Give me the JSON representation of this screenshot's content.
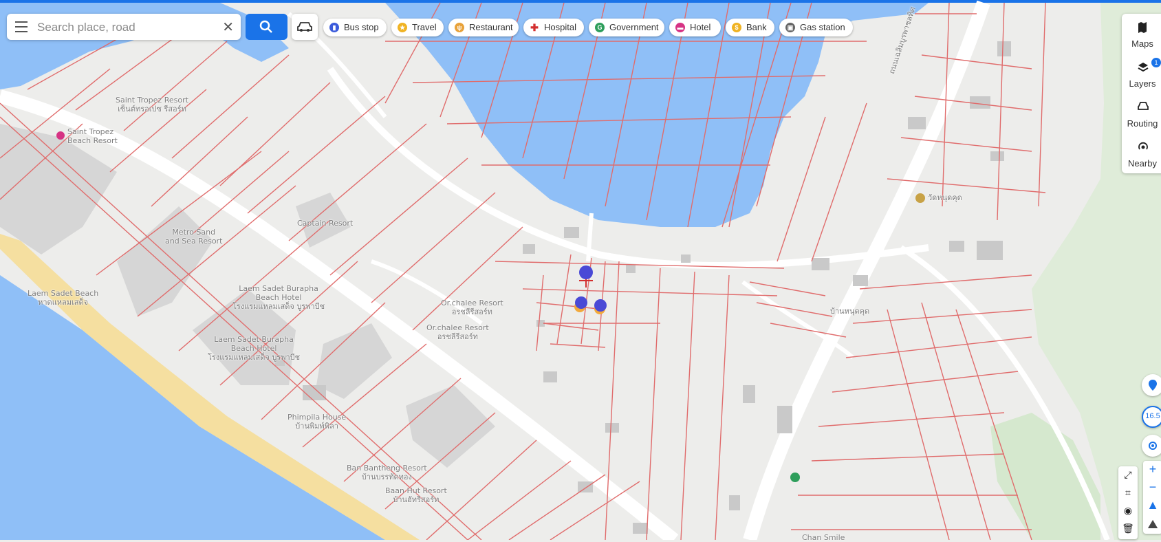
{
  "search": {
    "placeholder": "Search place, road",
    "value": ""
  },
  "categories": [
    {
      "label": "Bus stop",
      "icon": "bus-icon",
      "color": "#3b5bdb"
    },
    {
      "label": "Travel",
      "icon": "star-icon",
      "color": "#f0b323"
    },
    {
      "label": "Restaurant",
      "icon": "fork-knife-icon",
      "color": "#e8a23a"
    },
    {
      "label": "Hospital",
      "icon": "medical-cross-icon",
      "color": "#d32f2f"
    },
    {
      "label": "Government",
      "icon": "government-icon",
      "color": "#2e9e5b"
    },
    {
      "label": "Hotel",
      "icon": "bed-icon",
      "color": "#d63384"
    },
    {
      "label": "Bank",
      "icon": "coin-icon",
      "color": "#f0b323"
    },
    {
      "label": "Gas station",
      "icon": "fuel-pump-icon",
      "color": "#666666"
    }
  ],
  "side_panel": {
    "items": [
      {
        "label": "Maps",
        "icon": "map-icon"
      },
      {
        "label": "Layers",
        "icon": "layers-icon",
        "badge": "1"
      },
      {
        "label": "Routing",
        "icon": "car-icon"
      },
      {
        "label": "Nearby",
        "icon": "nearby-icon"
      }
    ]
  },
  "map_controls": {
    "zoom_level": "16.5",
    "zoom_in": "+",
    "zoom_out": "−"
  },
  "map_labels": {
    "l1": "Saint Tropez Resort",
    "l2": "เซ็นต์ทรอเปซ รีสอร์ท",
    "l3": "Saint Tropez",
    "l4": "Beach Resort",
    "l5": "Laem Sadet Beach",
    "l6": "หาดแหลมเสด็จ",
    "l7": "Laem Sadet Burapha",
    "l8": "Beach Hotel",
    "l9": "โรงแรมแหลมเสด็จ บูรพาบีช",
    "l10": "Laem Sadet Burapha",
    "l11": "Beach Hotel",
    "l12": "โรงแรมแหลมเสด็จ บูรพาบีช",
    "l13": "Metro Sand",
    "l14": "and Sea Resort",
    "l15": "Or.chalee Resort",
    "l16": "อรชลีรีสอร์ท",
    "l17": "Or.chalee Resort",
    "l18": "อรชลีรีสอร์ท",
    "l19": "Phimpila House",
    "l20": "บ้านพิมพ์พิลา",
    "l21": "Ban Bantheng Resort",
    "l22": "บ้านบรรทัดทอง",
    "l23": "Baan Hut Resort",
    "l24": "บ้านฮัทรีสอร์ท",
    "l25": "วัดหนุดคุด",
    "l26": "บ้านหนุดคุด",
    "l27": "ถนนเฉลิมบูรพาชลทิศ",
    "l28": "Chan Smile",
    "l29": "Captain Resort"
  },
  "colors": {
    "water": "#8fbff7",
    "land": "#ededeb",
    "beach": "#f5dfa0",
    "parcel": "#e06c6c",
    "road": "#ffffff",
    "accent": "#1a73e8",
    "marker": "#4a4ad6",
    "marker_base": "#f2a93b"
  }
}
